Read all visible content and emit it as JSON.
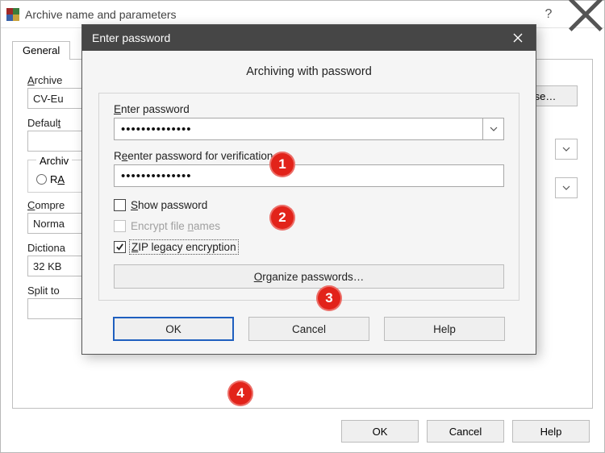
{
  "parent": {
    "title": "Archive name and parameters",
    "tab_general": "General",
    "archive_label": "Archive",
    "archive_value": "CV-Eu",
    "browse_label": "se…",
    "default_label": "Default",
    "archiveformat_label": "Archiv",
    "rar_label": "RA",
    "compression_label": "Compre",
    "compression_value": "Norma",
    "dictionary_label": "Dictiona",
    "dictionary_value": "32 KB",
    "splitto_label": "Split to",
    "btn_ok": "OK",
    "btn_cancel": "Cancel",
    "btn_help": "Help"
  },
  "modal": {
    "title": "Enter password",
    "heading": "Archiving with password",
    "enter_label": "Enter password",
    "enter_value": "••••••••••••••",
    "reenter_label": "Reenter password for verification",
    "reenter_value": "••••••••••••••",
    "show_label": "Show password",
    "encrypt_label": "Encrypt file names",
    "zip_label": "ZIP legacy encryption",
    "organize_label": "Organize passwords…",
    "btn_ok": "OK",
    "btn_cancel": "Cancel",
    "btn_help": "Help"
  },
  "callouts": {
    "c1": "1",
    "c2": "2",
    "c3": "3",
    "c4": "4"
  }
}
